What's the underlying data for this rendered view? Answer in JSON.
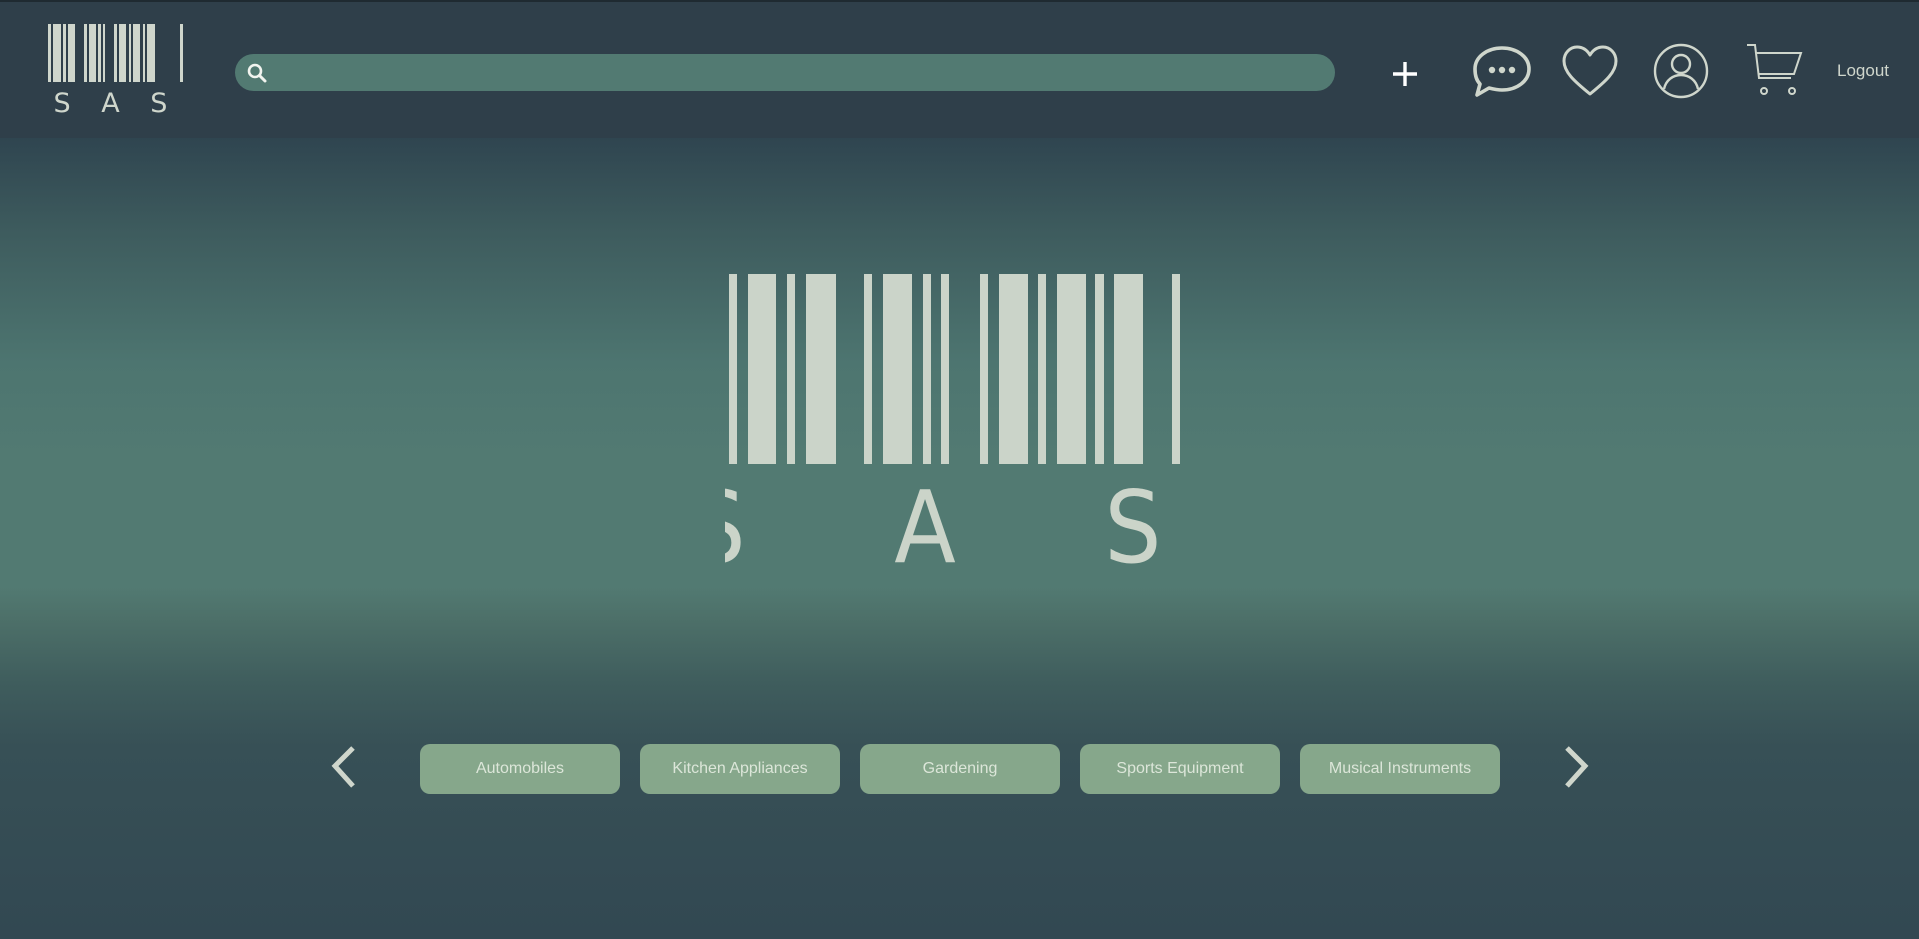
{
  "header": {
    "logo_text": "S A S",
    "search": {
      "value": "",
      "placeholder": ""
    },
    "actions": {
      "add": "plus-icon",
      "messages": "chat-bubble-icon",
      "wishlist": "heart-icon",
      "account": "user-icon",
      "cart": "cart-icon"
    },
    "logout_label": "Logout"
  },
  "hero": {
    "logo_text": "S A S"
  },
  "categories": {
    "items": [
      {
        "label": "Automobiles"
      },
      {
        "label": "Kitchen Appliances"
      },
      {
        "label": "Gardening"
      },
      {
        "label": "Sports Equipment"
      },
      {
        "label": "Musical Instruments"
      }
    ]
  },
  "colors": {
    "header_bg": "#2f3f4a",
    "search_bg": "#527a72",
    "icon_color": "#cfd6cc",
    "pill_bg": "#86a78b",
    "pill_text": "#dce6d9"
  }
}
